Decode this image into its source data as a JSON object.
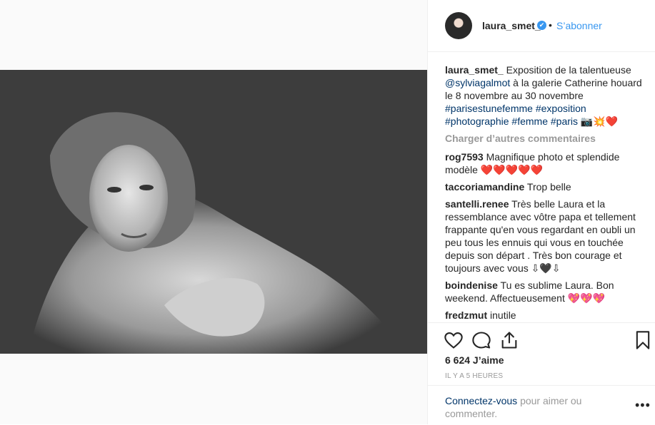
{
  "post": {
    "username": "laura_smet_",
    "verified_mark": "✔",
    "separator": "•",
    "follow_label": "S’abonner",
    "caption": {
      "user": "laura_smet_",
      "text_1": "Exposition de la talentueuse",
      "mention": "@sylviagalmot",
      "text_2": "à la galerie Catherine houard le 8 novembre au 30 novembre",
      "tags": "#parisestunefemme #exposition #photographie #femme #paris",
      "emoji": "📷💥❤️"
    },
    "load_more": "Charger d’autres commentaires",
    "comments": [
      {
        "user": "rog7593",
        "text": "Magnifique photo et splendide modèle",
        "emoji": "❤️❤️❤️❤️❤️"
      },
      {
        "user": "taccoriamandine",
        "text": "Trop belle",
        "emoji": ""
      },
      {
        "user": "santelli.renee",
        "text": "Très belle Laura et la ressemblance avec vôtre papa et tellement frappante qu'en vous regardant en oubli un peu tous les ennuis qui vous en touchée depuis son départ . Très bon courage et toujours avec vous",
        "emoji": "⇩🖤⇩"
      },
      {
        "user": "boindenise",
        "text": "Tu es sublime Laura. Bon weekend. Affectueusement",
        "emoji": "💖💖💖"
      },
      {
        "user": "fredzmut",
        "text": "inutile",
        "emoji": ""
      }
    ],
    "likes": "6 624 J’aime",
    "time": "IL Y A 5 HEURES",
    "login_link": "Connectez-vous",
    "login_text": "pour aimer ou commenter.",
    "more_label": "•••"
  },
  "icons": [
    "heart-icon",
    "comment-icon",
    "share-icon",
    "bookmark-icon"
  ],
  "colors": {
    "accent": "#3897f0",
    "link": "#003569",
    "muted": "#999999",
    "heart": "#ed4956"
  }
}
